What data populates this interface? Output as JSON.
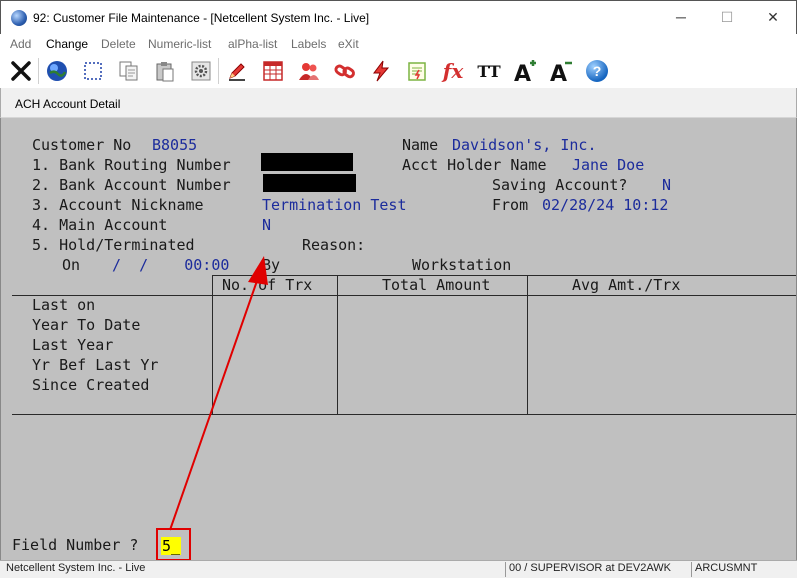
{
  "window": {
    "title": "92: Customer File Maintenance - [Netcellent System Inc. - Live]",
    "controls": {
      "minimize": "─",
      "maximize": "☐",
      "close": "✕"
    }
  },
  "menu": {
    "items": [
      "Add",
      "Change",
      "Delete",
      "Numeric-list",
      "alPha-list",
      "Labels",
      "eXit"
    ],
    "active": "Change"
  },
  "toolbar": {
    "icons": [
      "close-x-icon",
      "globe-icon",
      "select-rect-icon",
      "copy-icon",
      "paste-icon",
      "settings-gear-icon",
      "edit-pencil-icon",
      "table-icon",
      "users-icon",
      "link-icon",
      "lightning-icon",
      "notepad-icon",
      "function-fx-icon",
      "font-tt-icon",
      "font-increase-icon",
      "font-decrease-icon",
      "help-icon"
    ],
    "fx_label": "fx",
    "tt_label": "TT",
    "help_label": "?"
  },
  "panel": {
    "title": "ACH Account Detail"
  },
  "form": {
    "customer_no_label": "Customer No",
    "customer_no": "B8055",
    "name_label": "Name",
    "name": "Davidson's, Inc.",
    "bank_routing_label": "1. Bank Routing Number",
    "acct_holder_label": "Acct Holder Name",
    "acct_holder": "Jane Doe",
    "bank_account_label": "2. Bank Account Number",
    "saving_label": "Saving Account?",
    "saving": "N",
    "nickname_label": "3. Account Nickname",
    "nickname": "Termination Test",
    "from_label": "From",
    "from": "02/28/24 10:12",
    "main_account_label": "4. Main Account",
    "main_account": "N",
    "hold_label": "5. Hold/Terminated",
    "reason_label": "Reason:",
    "on_label": "On",
    "on_value": "/  /    00:00",
    "by_label": "By",
    "workstation_label": "Workstation"
  },
  "table": {
    "headers": [
      "No. of Trx",
      "Total Amount",
      "Avg Amt./Trx"
    ],
    "rows": [
      "Last on",
      "Year To Date",
      "Last Year",
      "Yr Bef Last Yr",
      "Since Created"
    ]
  },
  "prompt": {
    "label": "Field Number ?",
    "value": "5_"
  },
  "status": {
    "company": "Netcellent System Inc. - Live",
    "user": "00 / SUPERVISOR at DEV2AWK",
    "program": "ARCUSMNT"
  },
  "colors": {
    "screen_bg": "#c0c0c0",
    "data_text": "#1c2c9c",
    "label_text": "#1a1a1a",
    "input_highlight": "#ffff00",
    "annotation": "#e00000"
  }
}
